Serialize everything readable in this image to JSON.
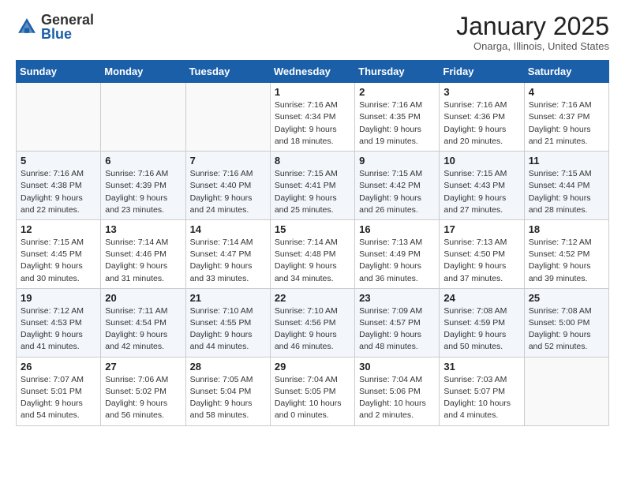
{
  "header": {
    "logo_general": "General",
    "logo_blue": "Blue",
    "month_title": "January 2025",
    "location": "Onarga, Illinois, United States"
  },
  "weekdays": [
    "Sunday",
    "Monday",
    "Tuesday",
    "Wednesday",
    "Thursday",
    "Friday",
    "Saturday"
  ],
  "weeks": [
    [
      {
        "day": "",
        "sunrise": "",
        "sunset": "",
        "daylight": ""
      },
      {
        "day": "",
        "sunrise": "",
        "sunset": "",
        "daylight": ""
      },
      {
        "day": "",
        "sunrise": "",
        "sunset": "",
        "daylight": ""
      },
      {
        "day": "1",
        "sunrise": "Sunrise: 7:16 AM",
        "sunset": "Sunset: 4:34 PM",
        "daylight": "Daylight: 9 hours and 18 minutes."
      },
      {
        "day": "2",
        "sunrise": "Sunrise: 7:16 AM",
        "sunset": "Sunset: 4:35 PM",
        "daylight": "Daylight: 9 hours and 19 minutes."
      },
      {
        "day": "3",
        "sunrise": "Sunrise: 7:16 AM",
        "sunset": "Sunset: 4:36 PM",
        "daylight": "Daylight: 9 hours and 20 minutes."
      },
      {
        "day": "4",
        "sunrise": "Sunrise: 7:16 AM",
        "sunset": "Sunset: 4:37 PM",
        "daylight": "Daylight: 9 hours and 21 minutes."
      }
    ],
    [
      {
        "day": "5",
        "sunrise": "Sunrise: 7:16 AM",
        "sunset": "Sunset: 4:38 PM",
        "daylight": "Daylight: 9 hours and 22 minutes."
      },
      {
        "day": "6",
        "sunrise": "Sunrise: 7:16 AM",
        "sunset": "Sunset: 4:39 PM",
        "daylight": "Daylight: 9 hours and 23 minutes."
      },
      {
        "day": "7",
        "sunrise": "Sunrise: 7:16 AM",
        "sunset": "Sunset: 4:40 PM",
        "daylight": "Daylight: 9 hours and 24 minutes."
      },
      {
        "day": "8",
        "sunrise": "Sunrise: 7:15 AM",
        "sunset": "Sunset: 4:41 PM",
        "daylight": "Daylight: 9 hours and 25 minutes."
      },
      {
        "day": "9",
        "sunrise": "Sunrise: 7:15 AM",
        "sunset": "Sunset: 4:42 PM",
        "daylight": "Daylight: 9 hours and 26 minutes."
      },
      {
        "day": "10",
        "sunrise": "Sunrise: 7:15 AM",
        "sunset": "Sunset: 4:43 PM",
        "daylight": "Daylight: 9 hours and 27 minutes."
      },
      {
        "day": "11",
        "sunrise": "Sunrise: 7:15 AM",
        "sunset": "Sunset: 4:44 PM",
        "daylight": "Daylight: 9 hours and 28 minutes."
      }
    ],
    [
      {
        "day": "12",
        "sunrise": "Sunrise: 7:15 AM",
        "sunset": "Sunset: 4:45 PM",
        "daylight": "Daylight: 9 hours and 30 minutes."
      },
      {
        "day": "13",
        "sunrise": "Sunrise: 7:14 AM",
        "sunset": "Sunset: 4:46 PM",
        "daylight": "Daylight: 9 hours and 31 minutes."
      },
      {
        "day": "14",
        "sunrise": "Sunrise: 7:14 AM",
        "sunset": "Sunset: 4:47 PM",
        "daylight": "Daylight: 9 hours and 33 minutes."
      },
      {
        "day": "15",
        "sunrise": "Sunrise: 7:14 AM",
        "sunset": "Sunset: 4:48 PM",
        "daylight": "Daylight: 9 hours and 34 minutes."
      },
      {
        "day": "16",
        "sunrise": "Sunrise: 7:13 AM",
        "sunset": "Sunset: 4:49 PM",
        "daylight": "Daylight: 9 hours and 36 minutes."
      },
      {
        "day": "17",
        "sunrise": "Sunrise: 7:13 AM",
        "sunset": "Sunset: 4:50 PM",
        "daylight": "Daylight: 9 hours and 37 minutes."
      },
      {
        "day": "18",
        "sunrise": "Sunrise: 7:12 AM",
        "sunset": "Sunset: 4:52 PM",
        "daylight": "Daylight: 9 hours and 39 minutes."
      }
    ],
    [
      {
        "day": "19",
        "sunrise": "Sunrise: 7:12 AM",
        "sunset": "Sunset: 4:53 PM",
        "daylight": "Daylight: 9 hours and 41 minutes."
      },
      {
        "day": "20",
        "sunrise": "Sunrise: 7:11 AM",
        "sunset": "Sunset: 4:54 PM",
        "daylight": "Daylight: 9 hours and 42 minutes."
      },
      {
        "day": "21",
        "sunrise": "Sunrise: 7:10 AM",
        "sunset": "Sunset: 4:55 PM",
        "daylight": "Daylight: 9 hours and 44 minutes."
      },
      {
        "day": "22",
        "sunrise": "Sunrise: 7:10 AM",
        "sunset": "Sunset: 4:56 PM",
        "daylight": "Daylight: 9 hours and 46 minutes."
      },
      {
        "day": "23",
        "sunrise": "Sunrise: 7:09 AM",
        "sunset": "Sunset: 4:57 PM",
        "daylight": "Daylight: 9 hours and 48 minutes."
      },
      {
        "day": "24",
        "sunrise": "Sunrise: 7:08 AM",
        "sunset": "Sunset: 4:59 PM",
        "daylight": "Daylight: 9 hours and 50 minutes."
      },
      {
        "day": "25",
        "sunrise": "Sunrise: 7:08 AM",
        "sunset": "Sunset: 5:00 PM",
        "daylight": "Daylight: 9 hours and 52 minutes."
      }
    ],
    [
      {
        "day": "26",
        "sunrise": "Sunrise: 7:07 AM",
        "sunset": "Sunset: 5:01 PM",
        "daylight": "Daylight: 9 hours and 54 minutes."
      },
      {
        "day": "27",
        "sunrise": "Sunrise: 7:06 AM",
        "sunset": "Sunset: 5:02 PM",
        "daylight": "Daylight: 9 hours and 56 minutes."
      },
      {
        "day": "28",
        "sunrise": "Sunrise: 7:05 AM",
        "sunset": "Sunset: 5:04 PM",
        "daylight": "Daylight: 9 hours and 58 minutes."
      },
      {
        "day": "29",
        "sunrise": "Sunrise: 7:04 AM",
        "sunset": "Sunset: 5:05 PM",
        "daylight": "Daylight: 10 hours and 0 minutes."
      },
      {
        "day": "30",
        "sunrise": "Sunrise: 7:04 AM",
        "sunset": "Sunset: 5:06 PM",
        "daylight": "Daylight: 10 hours and 2 minutes."
      },
      {
        "day": "31",
        "sunrise": "Sunrise: 7:03 AM",
        "sunset": "Sunset: 5:07 PM",
        "daylight": "Daylight: 10 hours and 4 minutes."
      },
      {
        "day": "",
        "sunrise": "",
        "sunset": "",
        "daylight": ""
      }
    ]
  ]
}
